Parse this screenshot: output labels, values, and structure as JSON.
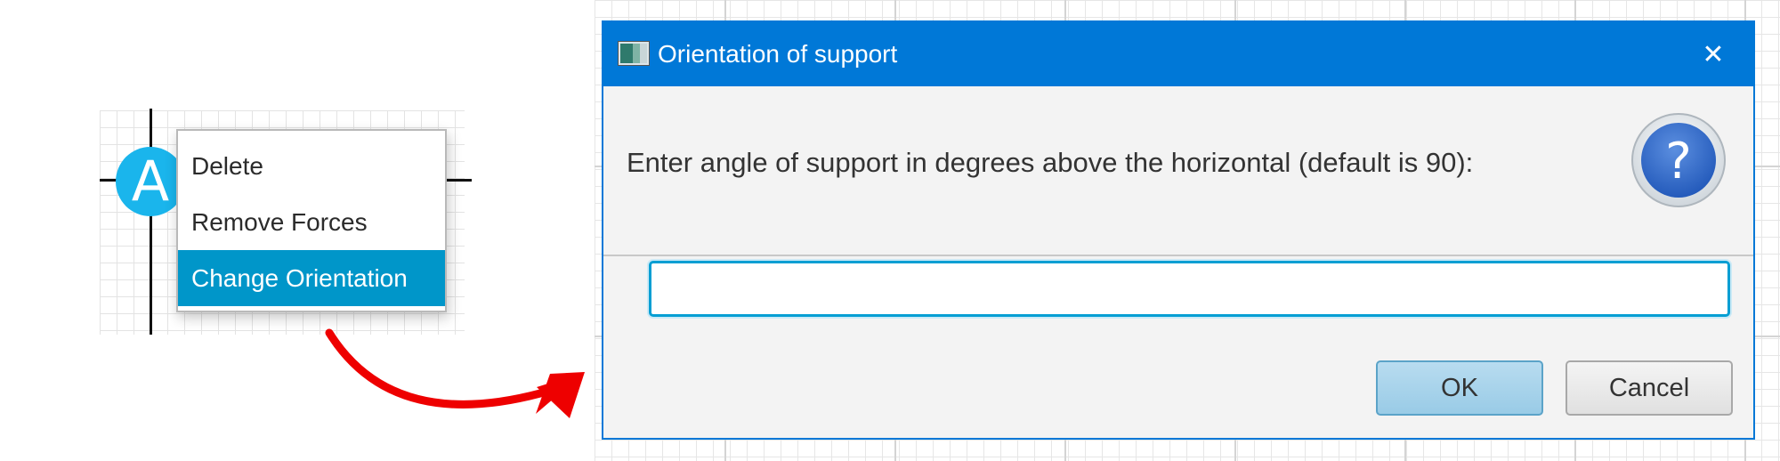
{
  "context_menu": {
    "node_label": "A",
    "items": [
      {
        "label": "Delete"
      },
      {
        "label": "Remove Forces"
      },
      {
        "label": "Change Orientation",
        "selected": true
      }
    ]
  },
  "dialog": {
    "title": "Orientation of support",
    "message": "Enter angle of support in degrees above the horizontal (default is 90):",
    "input_value": "",
    "ok_label": "OK",
    "cancel_label": "Cancel",
    "close_glyph": "✕",
    "help_glyph": "?"
  },
  "icons": {
    "app": "window-app-icon",
    "close": "close-icon",
    "help": "question-icon",
    "arrow": "red-curved-arrow-icon"
  },
  "colors": {
    "titlebar": "#0078d7",
    "menu_selected": "#0096c9",
    "node": "#1ab5ec",
    "arrow": "#ee0000",
    "input_focus": "#039ed3",
    "ok_button": "#a8d3ec"
  }
}
